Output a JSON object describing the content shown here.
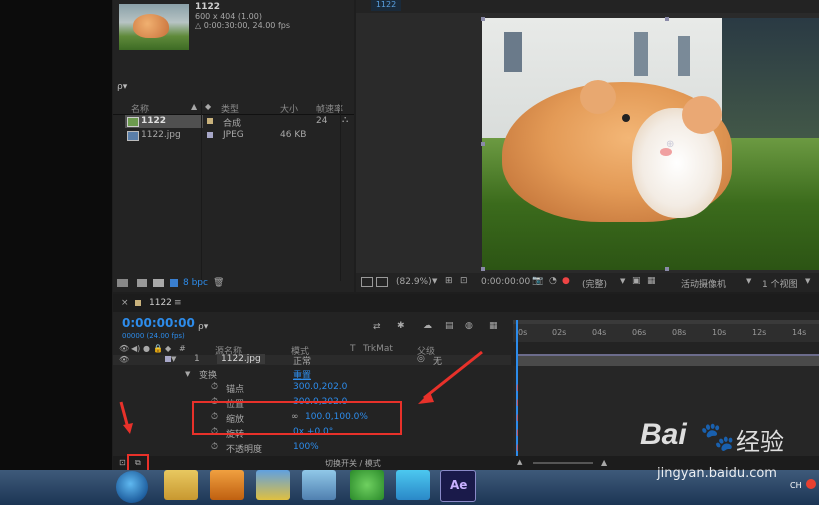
{
  "project": {
    "comp_name": "1122",
    "comp_size": "600 x 404 (1.00)",
    "comp_duration": "△ 0:00:30:00, 24.00 fps",
    "search_placeholder": "ρ▾",
    "columns": {
      "name": "名称",
      "type": "类型",
      "size": "大小",
      "fps": "帧速率"
    },
    "items": [
      {
        "name": "1122",
        "type": "合成",
        "size": "",
        "fps": "24",
        "color": "#c9b27c"
      },
      {
        "name": "1122.jpg",
        "type": "JPEG",
        "size": "46 KB",
        "fps": "",
        "color": "#a7a7c8"
      }
    ],
    "bpc": "8 bpc"
  },
  "viewer": {
    "tab": "1122",
    "zoom": "(82.9%)",
    "timecode": "0:00:00:00",
    "resolution": "(完整)",
    "camera": "活动摄像机",
    "views": "1 个视图"
  },
  "timeline": {
    "tab": "1122",
    "timecode": "0:00:00:00",
    "frames": "00000 (24.00 fps)",
    "search_placeholder": "ρ▾",
    "columns": {
      "source": "源名称",
      "mode": "模式",
      "t": "T",
      "trkmat": "TrkMat",
      "parent": "父级"
    },
    "layer": {
      "num": "1",
      "name": "1122.jpg",
      "mode": "正常",
      "parent": "无"
    },
    "transform": {
      "label": "变换",
      "reset": "重置"
    },
    "props": [
      {
        "name": "锚点",
        "value": "300.0,202.0"
      },
      {
        "name": "位置",
        "value": "300.0,202.0"
      },
      {
        "name": "缩放",
        "value": "100.0,100.0%"
      },
      {
        "name": "旋转",
        "value": "0x +0.0°"
      },
      {
        "name": "不透明度",
        "value": "100%"
      }
    ],
    "toggle_label": "切换开关 / 模式",
    "ruler": [
      "0s",
      "02s",
      "04s",
      "06s",
      "08s",
      "10s",
      "12s",
      "14s"
    ]
  },
  "taskbar": {
    "ae": "Ae",
    "tray": "CH"
  },
  "watermark": {
    "brand": "Bai",
    "cn": "经验",
    "url": "jingyan.baidu.com"
  },
  "colors": {
    "accent": "#2d8ceb",
    "annotation": "#e8312a",
    "label_orange": "#c9b27c"
  }
}
